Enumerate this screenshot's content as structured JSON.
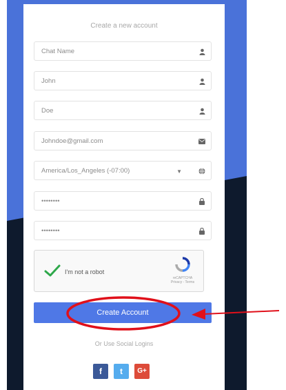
{
  "form": {
    "title": "Create a new account",
    "fields": [
      {
        "value": "Chat Name",
        "icon": "user-icon"
      },
      {
        "value": "John",
        "icon": "user-icon"
      },
      {
        "value": "Doe",
        "icon": "user-icon"
      },
      {
        "value": "Johndoe@gmail.com",
        "icon": "envelope-icon"
      },
      {
        "value": "America/Los_Angeles (-07:00)",
        "icon": "globe-icon"
      },
      {
        "value": "••••••••",
        "icon": "lock-icon"
      },
      {
        "value": "••••••••",
        "icon": "lock-icon"
      }
    ],
    "captcha": {
      "label": "I'm not a robot",
      "brand": "reCAPTCHA",
      "links": "Privacy - Terms"
    },
    "submit_label": "Create Account",
    "social_text": "Or Use Social Logins",
    "social": [
      {
        "name": "Facebook",
        "glyph": "f",
        "color": "#3b5998"
      },
      {
        "name": "Twitter",
        "glyph": "t",
        "color": "#55acee"
      },
      {
        "name": "Google Plus",
        "glyph": "G+",
        "color": "#dd4b39"
      }
    ]
  },
  "colors": {
    "accent": "#4f78e6",
    "background_top": "#4a72d9",
    "background_bottom": "#0e1a2d",
    "annotation": "#e0101a"
  }
}
